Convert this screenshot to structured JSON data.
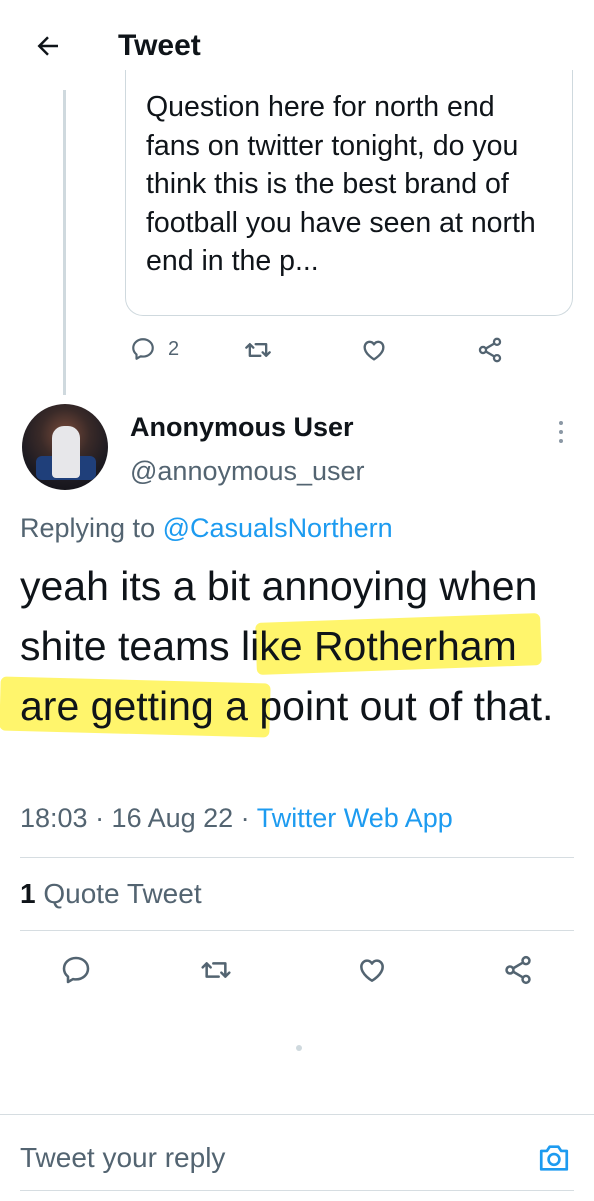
{
  "header": {
    "title": "Tweet"
  },
  "quoted_tweet": {
    "text": "Question here for north end fans on twitter tonight, do you think this is the best brand of football you have seen at north end in the p...",
    "actions": {
      "reply_count": "2"
    }
  },
  "tweet": {
    "author_name": "Anonymous User",
    "author_handle": "@annoymous_user",
    "replying_label": "Replying to",
    "replying_to": "@CasualsNorthern",
    "text": "yeah its a bit annoying when shite teams like Rotherham are getting a point out of that.",
    "timestamp": "18:03 · 16 Aug 22 · ",
    "source": "Twitter Web App",
    "quote_count": "1",
    "quote_label": " Quote Tweet"
  },
  "reply_bar": {
    "placeholder": "Tweet your reply"
  },
  "icons": {
    "back": "arrow-left-icon",
    "reply": "speech-bubble-icon",
    "retweet": "retweet-icon",
    "like": "heart-icon",
    "share": "share-icon",
    "more": "vertical-dots-icon",
    "camera": "camera-icon"
  },
  "colors": {
    "accent": "#1d9bf0",
    "secondary_text": "#536471",
    "highlight": "#fff23b"
  }
}
